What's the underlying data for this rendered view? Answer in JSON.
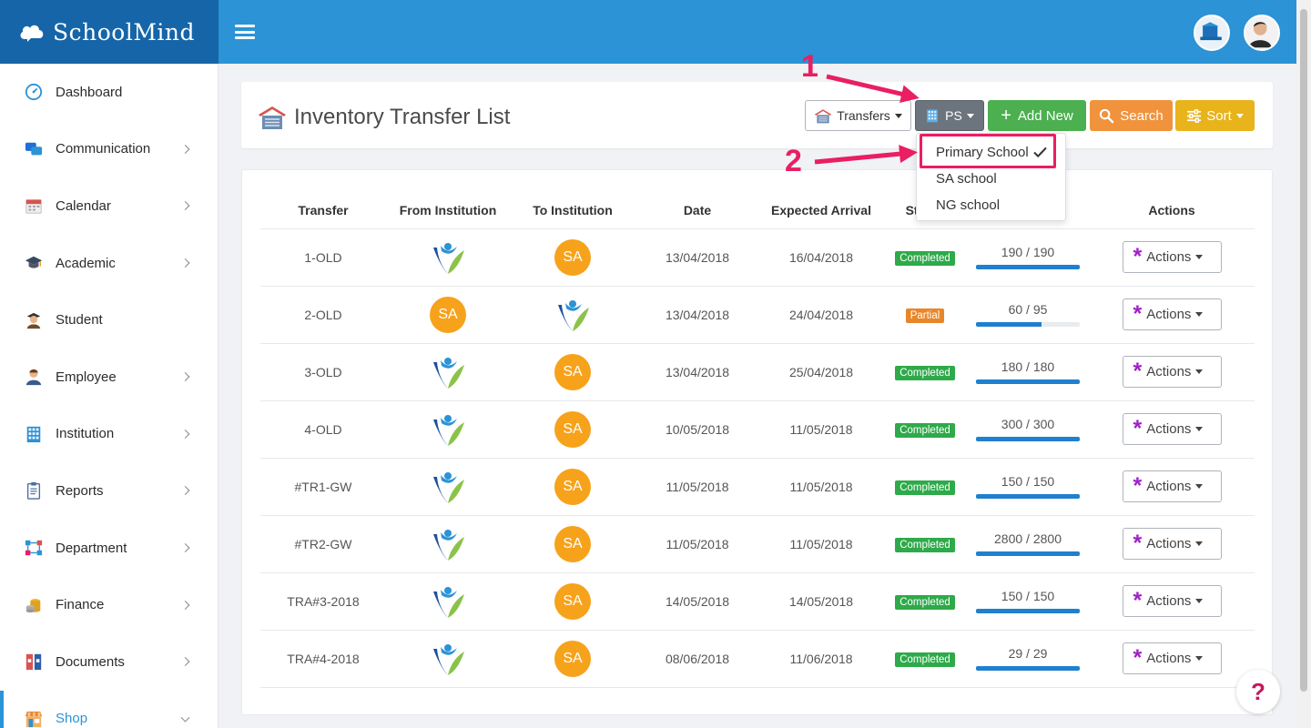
{
  "brand": {
    "name": "SchoolMind",
    "icon": "cloud-icon"
  },
  "header": {
    "menu_icon": "hamburger-icon",
    "avatars": [
      "institution-avatar",
      "user-avatar"
    ]
  },
  "sidebar": {
    "items": [
      {
        "label": "Dashboard",
        "icon": "dashboard-icon",
        "color": "#2b93d6",
        "has_chevron": false
      },
      {
        "label": "Communication",
        "icon": "chat-icon",
        "color": "#1e6fd9",
        "has_chevron": true
      },
      {
        "label": "Calendar",
        "icon": "calendar-icon",
        "color": "#d9534f",
        "has_chevron": true
      },
      {
        "label": "Academic",
        "icon": "graduation-cap-icon",
        "color": "#3a4a5e",
        "has_chevron": true
      },
      {
        "label": "Student",
        "icon": "student-icon",
        "color": "#6d4c2e",
        "has_chevron": false
      },
      {
        "label": "Employee",
        "icon": "employee-icon",
        "color": "#3a5a8c",
        "has_chevron": true
      },
      {
        "label": "Institution",
        "icon": "building-icon",
        "color": "#2b93d6",
        "has_chevron": true
      },
      {
        "label": "Reports",
        "icon": "clipboard-icon",
        "color": "#4a6fa5",
        "has_chevron": true
      },
      {
        "label": "Department",
        "icon": "department-icon",
        "color": "#2b93d6",
        "has_chevron": true
      },
      {
        "label": "Finance",
        "icon": "coins-icon",
        "color": "#e0a020",
        "has_chevron": true
      },
      {
        "label": "Documents",
        "icon": "documents-icon",
        "color": "#d9534f",
        "has_chevron": true
      },
      {
        "label": "Shop",
        "icon": "shop-icon",
        "color": "#e8862a",
        "has_chevron": true,
        "active": true
      }
    ]
  },
  "page": {
    "title": "Inventory Transfer List",
    "title_icon": "warehouse-icon",
    "buttons": {
      "transfers": "Transfers",
      "ps": "PS",
      "add_new": "Add New",
      "search": "Search",
      "sort": "Sort"
    }
  },
  "dropdown": {
    "items": [
      {
        "label": "Primary School",
        "checked": true
      },
      {
        "label": "SA school",
        "checked": false
      },
      {
        "label": "NG school",
        "checked": false
      }
    ]
  },
  "annotations": {
    "one": "1",
    "two": "2"
  },
  "table": {
    "headers": [
      "Transfer",
      "From Institution",
      "To Institution",
      "Date",
      "Expected Arrival",
      "Status",
      "",
      "Actions"
    ],
    "action_label": "Actions",
    "rows": [
      {
        "transfer": "1-OLD",
        "from": "logo",
        "to": "SA",
        "date": "13/04/2018",
        "arrival": "16/04/2018",
        "status": "Completed",
        "qty": "190 / 190",
        "progress": 1.0
      },
      {
        "transfer": "2-OLD",
        "from": "SA",
        "to": "logo",
        "date": "13/04/2018",
        "arrival": "24/04/2018",
        "status": "Partial",
        "qty": "60 / 95",
        "progress": 0.63
      },
      {
        "transfer": "3-OLD",
        "from": "logo",
        "to": "SA",
        "date": "13/04/2018",
        "arrival": "25/04/2018",
        "status": "Completed",
        "qty": "180 / 180",
        "progress": 1.0
      },
      {
        "transfer": "4-OLD",
        "from": "logo",
        "to": "SA",
        "date": "10/05/2018",
        "arrival": "11/05/2018",
        "status": "Completed",
        "qty": "300 / 300",
        "progress": 1.0
      },
      {
        "transfer": "#TR1-GW",
        "from": "logo",
        "to": "SA",
        "date": "11/05/2018",
        "arrival": "11/05/2018",
        "status": "Completed",
        "qty": "150 / 150",
        "progress": 1.0
      },
      {
        "transfer": "#TR2-GW",
        "from": "logo",
        "to": "SA",
        "date": "11/05/2018",
        "arrival": "11/05/2018",
        "status": "Completed",
        "qty": "2800 / 2800",
        "progress": 1.0
      },
      {
        "transfer": "TRA#3-2018",
        "from": "logo",
        "to": "SA",
        "date": "14/05/2018",
        "arrival": "14/05/2018",
        "status": "Completed",
        "qty": "150 / 150",
        "progress": 1.0
      },
      {
        "transfer": "TRA#4-2018",
        "from": "logo",
        "to": "SA",
        "date": "08/06/2018",
        "arrival": "11/06/2018",
        "status": "Completed",
        "qty": "29 / 29",
        "progress": 1.0
      }
    ]
  },
  "help": {
    "label": "?"
  },
  "colors": {
    "header": "#2b93d6",
    "brand": "#1565a8",
    "add": "#4caf50",
    "search": "#f0933c",
    "sort": "#e8b31b",
    "annotation": "#e91e63",
    "sa": "#f7a21b"
  }
}
